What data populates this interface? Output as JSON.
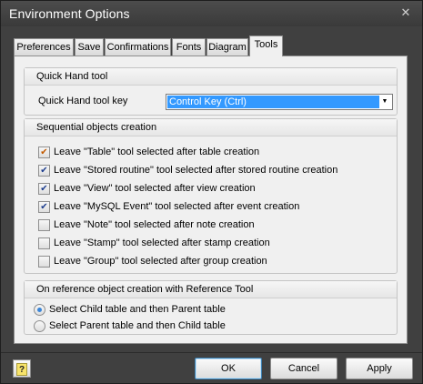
{
  "window": {
    "title": "Environment Options",
    "close_glyph": "✕"
  },
  "tabs": [
    {
      "label": "Preferences"
    },
    {
      "label": "Save"
    },
    {
      "label": "Confirmations"
    },
    {
      "label": "Fonts"
    },
    {
      "label": "Diagram"
    },
    {
      "label": "Tools",
      "active": true
    }
  ],
  "quick_hand": {
    "header": "Quick Hand tool",
    "label": "Quick Hand tool key",
    "value": "Control Key (Ctrl)"
  },
  "sequential": {
    "header": "Sequential objects creation",
    "options": [
      {
        "label": "Leave \"Table\" tool selected after table creation",
        "checked": true
      },
      {
        "label": "Leave \"Stored routine\" tool selected after stored routine creation",
        "checked": true
      },
      {
        "label": "Leave \"View\" tool selected after view creation",
        "checked": true
      },
      {
        "label": "Leave \"MySQL Event\" tool selected after event creation",
        "checked": true
      },
      {
        "label": "Leave \"Note\" tool selected after note creation",
        "checked": false
      },
      {
        "label": "Leave \"Stamp\" tool selected after stamp creation",
        "checked": false
      },
      {
        "label": "Leave \"Group\" tool selected after group creation",
        "checked": false
      }
    ]
  },
  "reference": {
    "header": "On reference object creation with Reference Tool",
    "options": [
      {
        "label": "Select Child table and then Parent table",
        "selected": true
      },
      {
        "label": "Select Parent table and then Child table",
        "selected": false
      }
    ]
  },
  "footer": {
    "ok": "OK",
    "cancel": "Cancel",
    "apply": "Apply",
    "help_glyph": "?"
  },
  "colors": {
    "selection": "#3399ff",
    "title_bg": "#404040",
    "panel_bg": "#f0f0f0"
  }
}
